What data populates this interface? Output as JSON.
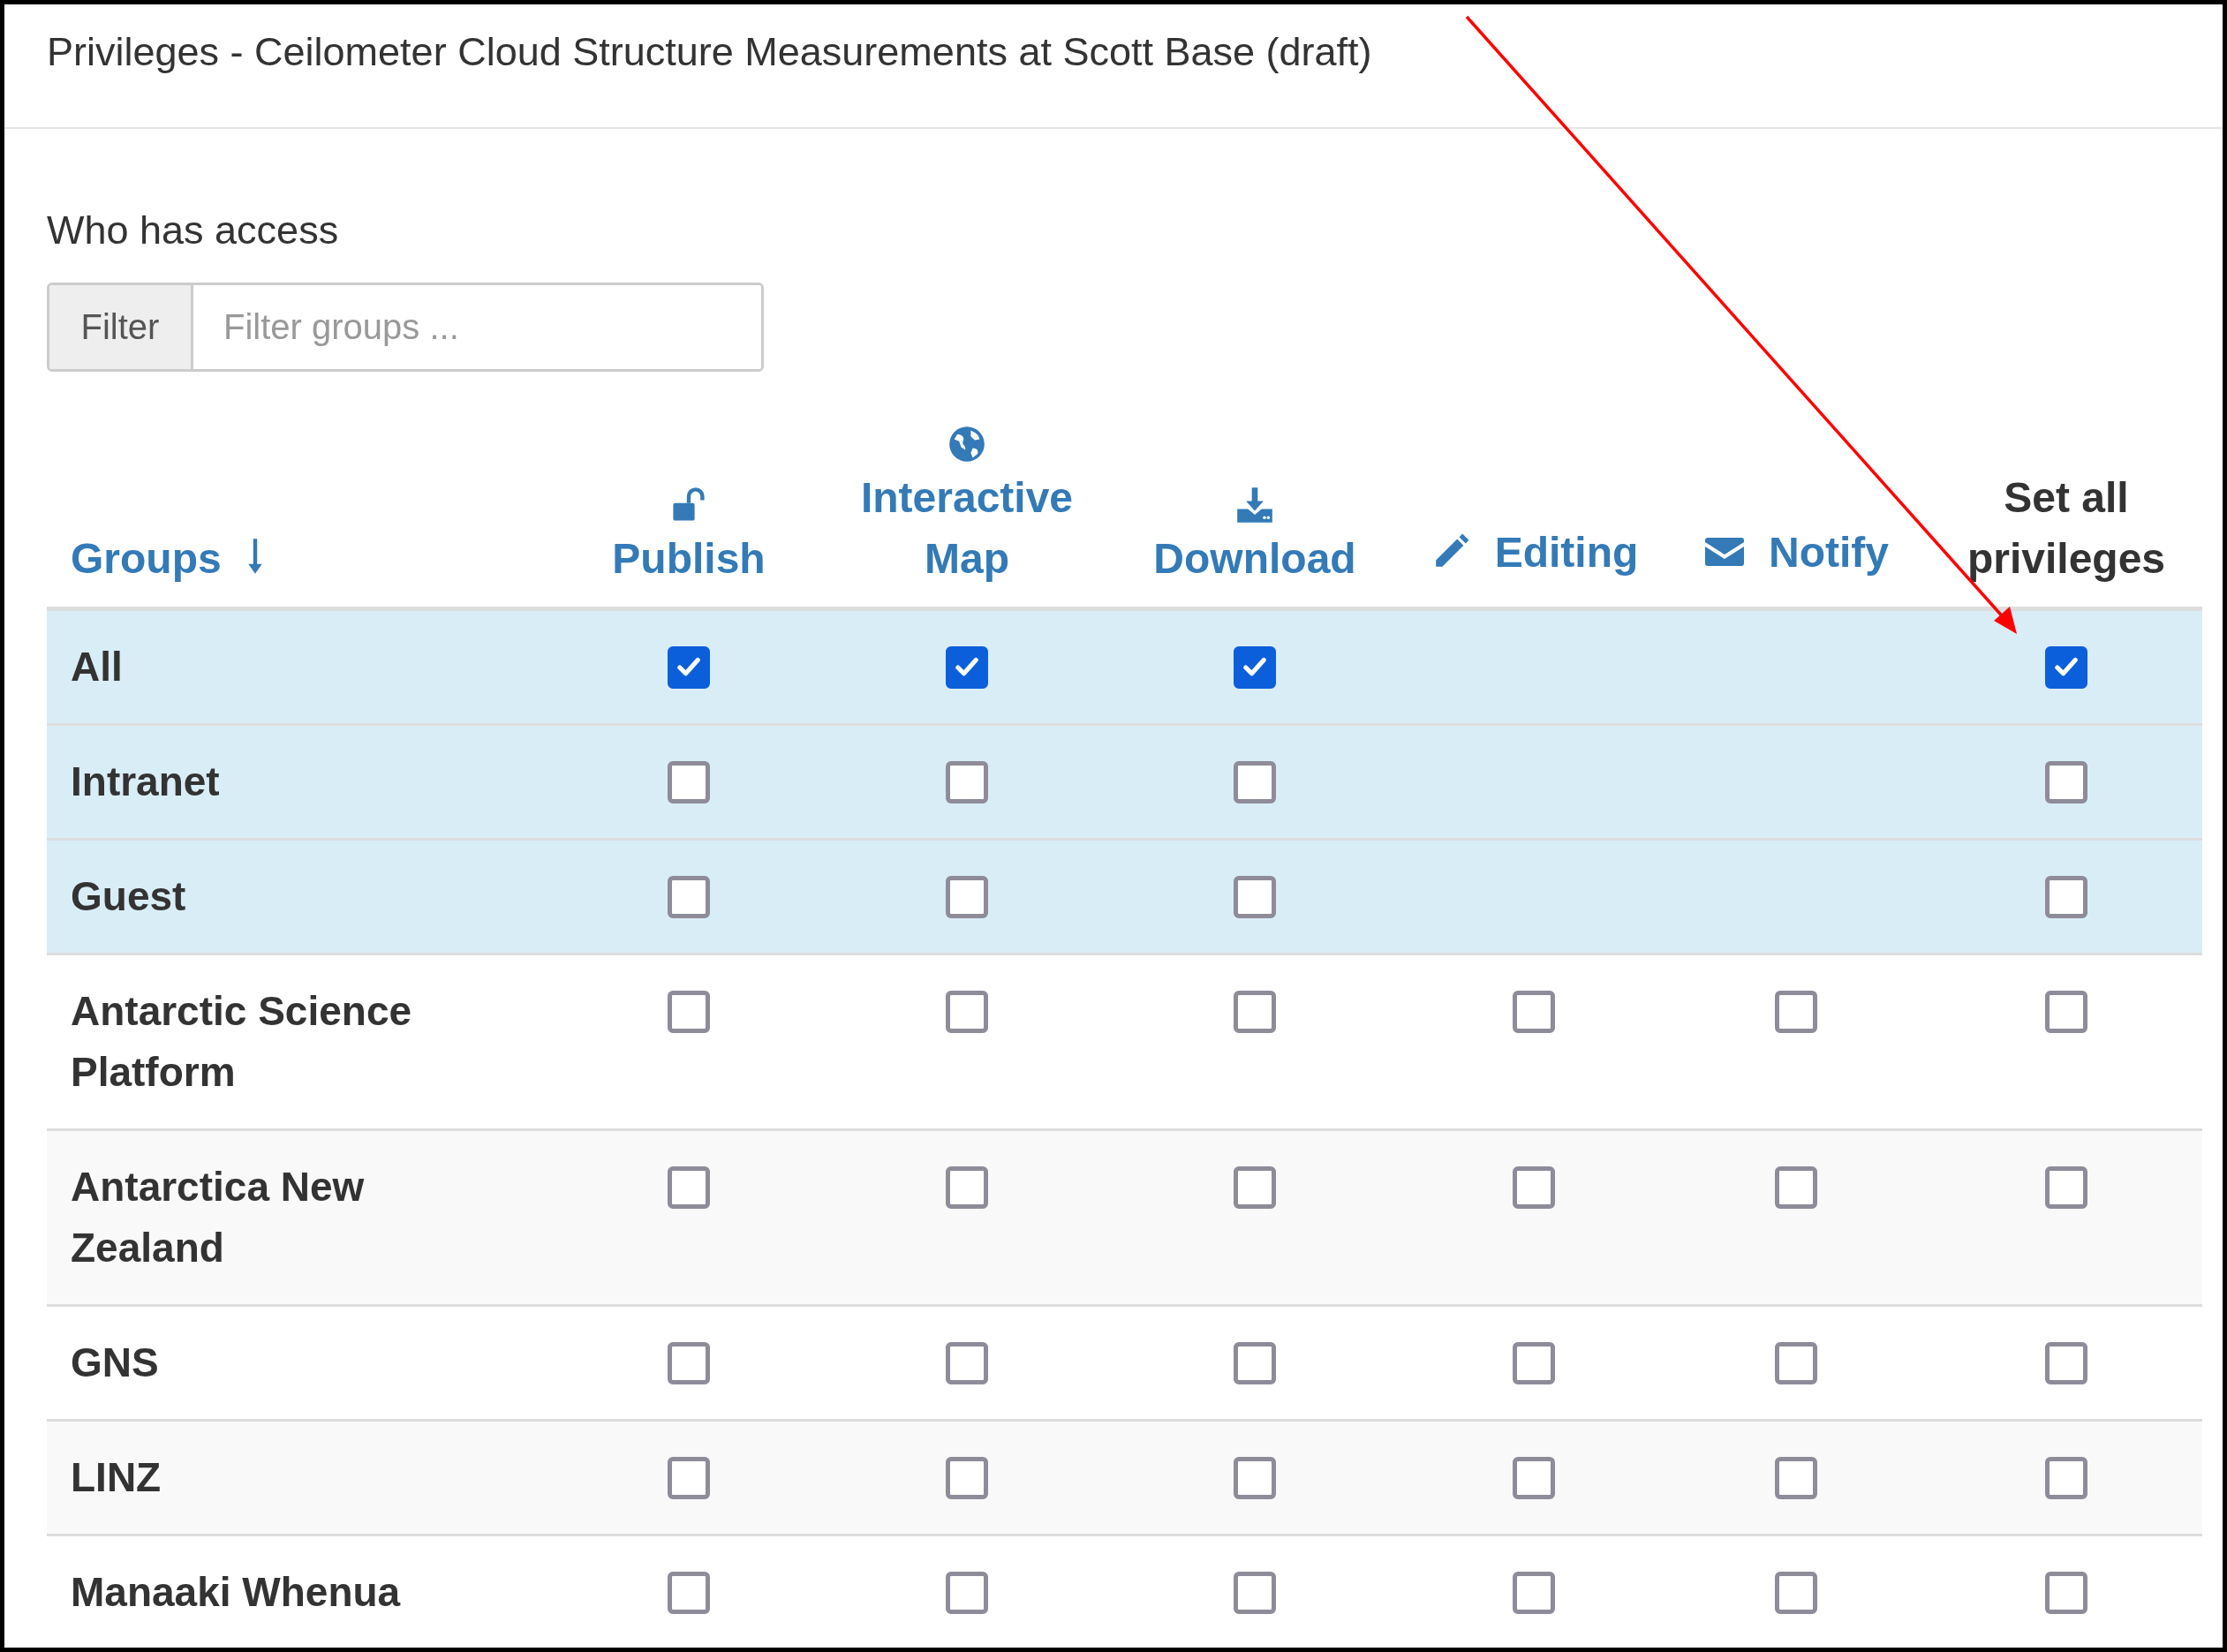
{
  "window": {
    "title": "Privileges - Ceilometer Cloud Structure Measurements at Scott Base (draft)"
  },
  "section_title": "Who has access",
  "filter": {
    "label": "Filter",
    "placeholder": "Filter groups ..."
  },
  "columns": [
    {
      "label": "Groups",
      "kind": "sort"
    },
    {
      "label": "Publish",
      "kind": "icon-above"
    },
    {
      "label": "Interactive Map",
      "kind": "icon-above"
    },
    {
      "label": "Download",
      "kind": "icon-above"
    },
    {
      "label": "Editing",
      "kind": "icon-inline"
    },
    {
      "label": "Notify",
      "kind": "icon-inline"
    },
    {
      "label": "Set all privileges",
      "kind": "plain"
    }
  ],
  "rows": [
    {
      "name": "All",
      "highlighted": true,
      "cells": [
        {
          "kind": "checkbox",
          "checked": true
        },
        {
          "kind": "checkbox",
          "checked": true
        },
        {
          "kind": "checkbox",
          "checked": true
        },
        {
          "kind": "blank"
        },
        {
          "kind": "blank"
        },
        {
          "kind": "checkbox",
          "checked": true
        }
      ]
    },
    {
      "name": "Intranet",
      "highlighted": true,
      "cells": [
        {
          "kind": "checkbox",
          "checked": false
        },
        {
          "kind": "checkbox",
          "checked": false
        },
        {
          "kind": "checkbox",
          "checked": false
        },
        {
          "kind": "blank"
        },
        {
          "kind": "blank"
        },
        {
          "kind": "checkbox",
          "checked": false
        }
      ]
    },
    {
      "name": "Guest",
      "highlighted": true,
      "cells": [
        {
          "kind": "checkbox",
          "checked": false
        },
        {
          "kind": "checkbox",
          "checked": false
        },
        {
          "kind": "checkbox",
          "checked": false
        },
        {
          "kind": "blank"
        },
        {
          "kind": "blank"
        },
        {
          "kind": "checkbox",
          "checked": false
        }
      ]
    },
    {
      "name": "Antarctic Science Platform",
      "highlighted": false,
      "cells": [
        {
          "kind": "checkbox",
          "checked": false
        },
        {
          "kind": "checkbox",
          "checked": false
        },
        {
          "kind": "checkbox",
          "checked": false
        },
        {
          "kind": "checkbox",
          "checked": false
        },
        {
          "kind": "checkbox",
          "checked": false
        },
        {
          "kind": "checkbox",
          "checked": false
        }
      ]
    },
    {
      "name": "Antarctica New Zealand",
      "highlighted": false,
      "cells": [
        {
          "kind": "checkbox",
          "checked": false
        },
        {
          "kind": "checkbox",
          "checked": false
        },
        {
          "kind": "checkbox",
          "checked": false
        },
        {
          "kind": "checkbox",
          "checked": false
        },
        {
          "kind": "checkbox",
          "checked": false
        },
        {
          "kind": "checkbox",
          "checked": false
        }
      ]
    },
    {
      "name": "GNS",
      "highlighted": false,
      "cells": [
        {
          "kind": "checkbox",
          "checked": false
        },
        {
          "kind": "checkbox",
          "checked": false
        },
        {
          "kind": "checkbox",
          "checked": false
        },
        {
          "kind": "checkbox",
          "checked": false
        },
        {
          "kind": "checkbox",
          "checked": false
        },
        {
          "kind": "checkbox",
          "checked": false
        }
      ]
    },
    {
      "name": "LINZ",
      "highlighted": false,
      "cells": [
        {
          "kind": "checkbox",
          "checked": false
        },
        {
          "kind": "checkbox",
          "checked": false
        },
        {
          "kind": "checkbox",
          "checked": false
        },
        {
          "kind": "checkbox",
          "checked": false
        },
        {
          "kind": "checkbox",
          "checked": false
        },
        {
          "kind": "checkbox",
          "checked": false
        }
      ]
    },
    {
      "name": "Manaaki Whenua",
      "highlighted": false,
      "cells": [
        {
          "kind": "checkbox",
          "checked": false
        },
        {
          "kind": "checkbox",
          "checked": false
        },
        {
          "kind": "checkbox",
          "checked": false
        },
        {
          "kind": "checkbox",
          "checked": false
        },
        {
          "kind": "checkbox",
          "checked": false
        },
        {
          "kind": "checkbox",
          "checked": false
        }
      ]
    }
  ]
}
